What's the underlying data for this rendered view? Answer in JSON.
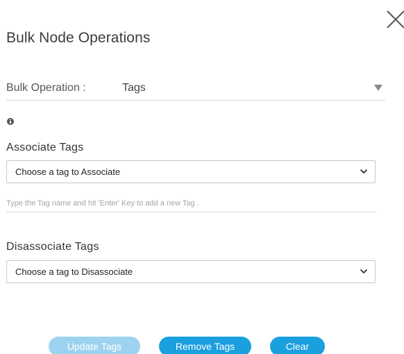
{
  "dialog": {
    "title": "Bulk Node Operations"
  },
  "bulk_operation": {
    "label": "Bulk Operation :",
    "value": "Tags"
  },
  "associate": {
    "heading": "Associate Tags",
    "select_value": "Choose a tag to Associate",
    "new_tag_placeholder": "Type the Tag name and hit 'Enter' Key to add a new Tag ."
  },
  "disassociate": {
    "heading": "Disassociate Tags",
    "select_value": "Choose a tag to Disassociate"
  },
  "buttons": {
    "update": "Update Tags",
    "remove": "Remove Tags",
    "clear": "Clear"
  },
  "icons": {
    "close": "close-icon",
    "info": "info-icon",
    "caret": "caret-down-icon",
    "chevron": "chevron-down-icon"
  },
  "colors": {
    "primary": "#1a9fdf",
    "primary_disabled": "#9dd2f0"
  }
}
